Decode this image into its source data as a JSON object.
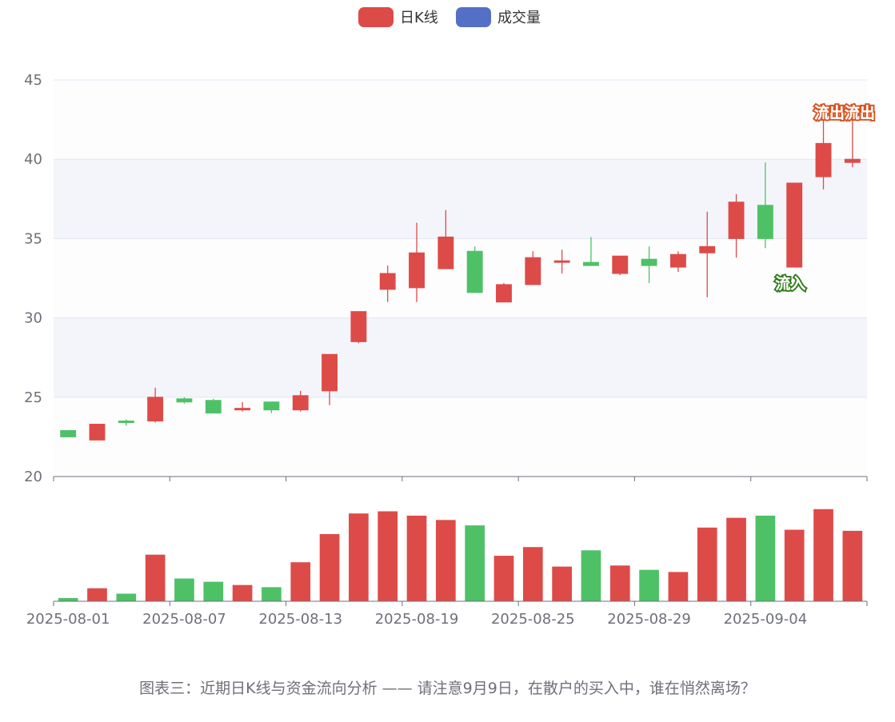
{
  "chart_data": {
    "type": "candlestick",
    "legend": [
      {
        "name": "日K线",
        "color": "#dd4b49"
      },
      {
        "name": "成交量",
        "color": "#5470c6"
      }
    ],
    "legend_position": "top-center",
    "colors": {
      "up": "#dd4b49",
      "down": "#4ec167",
      "band": "#f4f5fa",
      "grid": "#e0e6f1",
      "axis": "#6e7079"
    },
    "price_axis": {
      "min": 20,
      "max": 45,
      "interval": 5,
      "ticks": [
        "20",
        "25",
        "30",
        "35",
        "40",
        "45"
      ]
    },
    "x_labels": [
      {
        "index": 0,
        "text": "2025-08-01"
      },
      {
        "index": 4,
        "text": "2025-08-07"
      },
      {
        "index": 8,
        "text": "2025-08-13"
      },
      {
        "index": 12,
        "text": "2025-08-19"
      },
      {
        "index": 16,
        "text": "2025-08-25"
      },
      {
        "index": 20,
        "text": "2025-08-29"
      },
      {
        "index": 24,
        "text": "2025-09-04"
      }
    ],
    "candles": [
      {
        "o": 22.9,
        "c": 22.5,
        "l": 22.5,
        "h": 22.9
      },
      {
        "o": 22.3,
        "c": 23.3,
        "l": 22.3,
        "h": 23.3
      },
      {
        "o": 23.5,
        "c": 23.4,
        "l": 23.2,
        "h": 23.6
      },
      {
        "o": 23.5,
        "c": 25.0,
        "l": 23.4,
        "h": 25.6
      },
      {
        "o": 24.9,
        "c": 24.7,
        "l": 24.6,
        "h": 25.0
      },
      {
        "o": 24.8,
        "c": 24.0,
        "l": 24.0,
        "h": 24.9
      },
      {
        "o": 24.2,
        "c": 24.3,
        "l": 24.1,
        "h": 24.7
      },
      {
        "o": 24.7,
        "c": 24.2,
        "l": 24.0,
        "h": 24.7
      },
      {
        "o": 24.2,
        "c": 25.1,
        "l": 24.1,
        "h": 25.4
      },
      {
        "o": 25.4,
        "c": 27.7,
        "l": 24.5,
        "h": 27.7
      },
      {
        "o": 28.5,
        "c": 30.4,
        "l": 28.4,
        "h": 30.4
      },
      {
        "o": 31.8,
        "c": 32.8,
        "l": 31.0,
        "h": 33.3
      },
      {
        "o": 31.9,
        "c": 34.1,
        "l": 31.0,
        "h": 36.0
      },
      {
        "o": 33.1,
        "c": 35.1,
        "l": 33.1,
        "h": 36.8
      },
      {
        "o": 34.2,
        "c": 31.6,
        "l": 31.6,
        "h": 34.5
      },
      {
        "o": 31.0,
        "c": 32.1,
        "l": 31.0,
        "h": 32.2
      },
      {
        "o": 32.1,
        "c": 33.8,
        "l": 32.1,
        "h": 34.2
      },
      {
        "o": 33.5,
        "c": 33.6,
        "l": 32.8,
        "h": 34.3
      },
      {
        "o": 33.5,
        "c": 33.3,
        "l": 33.3,
        "h": 35.1
      },
      {
        "o": 32.8,
        "c": 33.9,
        "l": 32.7,
        "h": 33.9
      },
      {
        "o": 33.7,
        "c": 33.3,
        "l": 32.2,
        "h": 34.5
      },
      {
        "o": 33.2,
        "c": 34.0,
        "l": 32.9,
        "h": 34.2
      },
      {
        "o": 34.1,
        "c": 34.5,
        "l": 31.3,
        "h": 36.7
      },
      {
        "o": 35.0,
        "c": 37.3,
        "l": 33.8,
        "h": 37.8
      },
      {
        "o": 37.1,
        "c": 35.0,
        "l": 34.4,
        "h": 39.8
      },
      {
        "o": 33.2,
        "c": 38.5,
        "l": 33.2,
        "h": 38.5
      },
      {
        "o": 38.9,
        "c": 41.0,
        "l": 38.1,
        "h": 42.5
      },
      {
        "o": 39.8,
        "c": 40.0,
        "l": 39.5,
        "h": 42.5
      }
    ],
    "volume": [
      {
        "v": 3,
        "up": false
      },
      {
        "v": 12,
        "up": true
      },
      {
        "v": 7,
        "up": false
      },
      {
        "v": 43,
        "up": true
      },
      {
        "v": 21,
        "up": false
      },
      {
        "v": 18,
        "up": false
      },
      {
        "v": 15,
        "up": true
      },
      {
        "v": 13,
        "up": false
      },
      {
        "v": 36,
        "up": true
      },
      {
        "v": 62,
        "up": true
      },
      {
        "v": 81,
        "up": true
      },
      {
        "v": 83,
        "up": true
      },
      {
        "v": 79,
        "up": true
      },
      {
        "v": 75,
        "up": true
      },
      {
        "v": 70,
        "up": false
      },
      {
        "v": 42,
        "up": true
      },
      {
        "v": 50,
        "up": true
      },
      {
        "v": 32,
        "up": true
      },
      {
        "v": 47,
        "up": false
      },
      {
        "v": 33,
        "up": true
      },
      {
        "v": 29,
        "up": false
      },
      {
        "v": 27,
        "up": true
      },
      {
        "v": 68,
        "up": true
      },
      {
        "v": 77,
        "up": true
      },
      {
        "v": 79,
        "up": false
      },
      {
        "v": 66,
        "up": true
      },
      {
        "v": 85,
        "up": true
      },
      {
        "v": 65,
        "up": true
      }
    ],
    "volume_max": 90,
    "annotations": [
      {
        "index": 25,
        "price": 32.8,
        "text": "流入",
        "color": "#2e7d1a",
        "anchor": "below"
      },
      {
        "index": 27,
        "price": 43.0,
        "text": "流出流出",
        "color": "#d9531e",
        "anchor": "right"
      }
    ]
  },
  "caption": "图表三：近期日K线与资金流向分析 —— 请注意9月9日，在散户的买入中，谁在悄然离场？"
}
